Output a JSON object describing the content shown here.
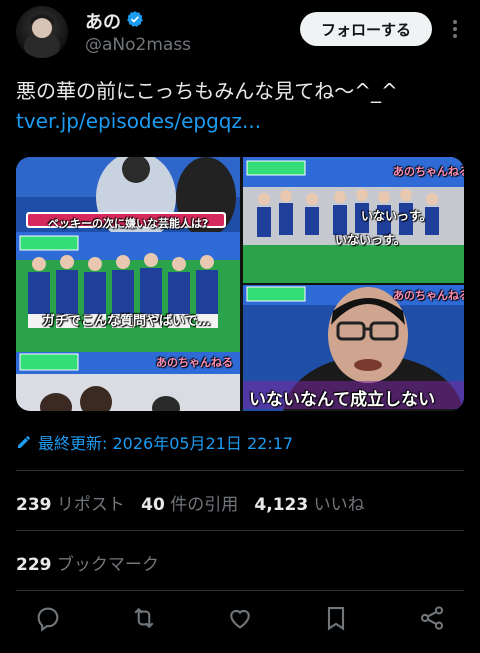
{
  "author": {
    "display_name": "あの",
    "handle": "@aNo2mass",
    "verified": true,
    "follow_label": "フォローする"
  },
  "tweet": {
    "text": "悪の華の前にこっちもみんな見てね〜^_^",
    "link": "tver.jp/episodes/epgqz..."
  },
  "media": {
    "tl_caption": "ベッキーの次に嫌いな芸能人は?",
    "ml_caption": "ガチでこんな質問やばいで…",
    "tr_caption1": "いないっす。",
    "tr_caption2": "いないっす。",
    "br_caption": "いないなんて成立しない",
    "show_logo": "あのちゃんねる"
  },
  "edited_label": "最終更新: 2026年05月21日 22:17",
  "stats": {
    "reposts_count": "239",
    "reposts_label": "リポスト",
    "quotes_count": "40",
    "quotes_label": "件の引用",
    "likes_count": "4,123",
    "likes_label": "いいね"
  },
  "bookmarks": {
    "count": "229",
    "label": "ブックマーク"
  },
  "colors": {
    "accent": "#1d9bf0",
    "text": "#e7e9ea",
    "muted": "#71767b",
    "border": "#2f3336"
  },
  "actions": [
    "reply-icon",
    "repost-icon",
    "like-icon",
    "bookmark-icon",
    "share-icon"
  ]
}
